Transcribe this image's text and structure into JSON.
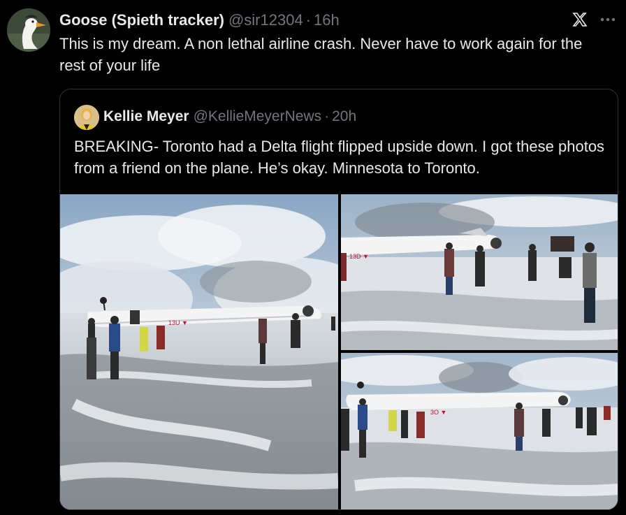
{
  "tweet": {
    "author": {
      "display_name": "Goose (Spieth tracker)",
      "handle": "@sir12304",
      "avatar_icon": "goose-avatar"
    },
    "separator": "·",
    "time": "16h",
    "text": "This is my dream. A non lethal airline crash. Never have to work again for the rest of your life",
    "icons": {
      "logo": "x-logo-icon",
      "more": "more-icon"
    }
  },
  "quoted_tweet": {
    "author": {
      "display_name": "Kellie Meyer",
      "handle": "@KellieMeyerNews",
      "avatar_icon": "kellie-avatar"
    },
    "separator": "·",
    "time": "20h",
    "text": "BREAKING- Toronto had a Delta flight flipped upside down. I got these photos from a friend on the plane. He’s okay. Minnesota to Toronto.",
    "media": [
      {
        "description_icon": "photo-plane-crash-1",
        "fuselage_text": "13U ▼"
      },
      {
        "description_icon": "photo-plane-crash-2",
        "fuselage_text": "13D ▼"
      },
      {
        "description_icon": "photo-plane-crash-3",
        "fuselage_text": "3O ▼"
      }
    ]
  },
  "colors": {
    "background": "#000000",
    "primary_text": "#e7e9ea",
    "secondary_text": "#71767b",
    "border": "#2f3336"
  }
}
